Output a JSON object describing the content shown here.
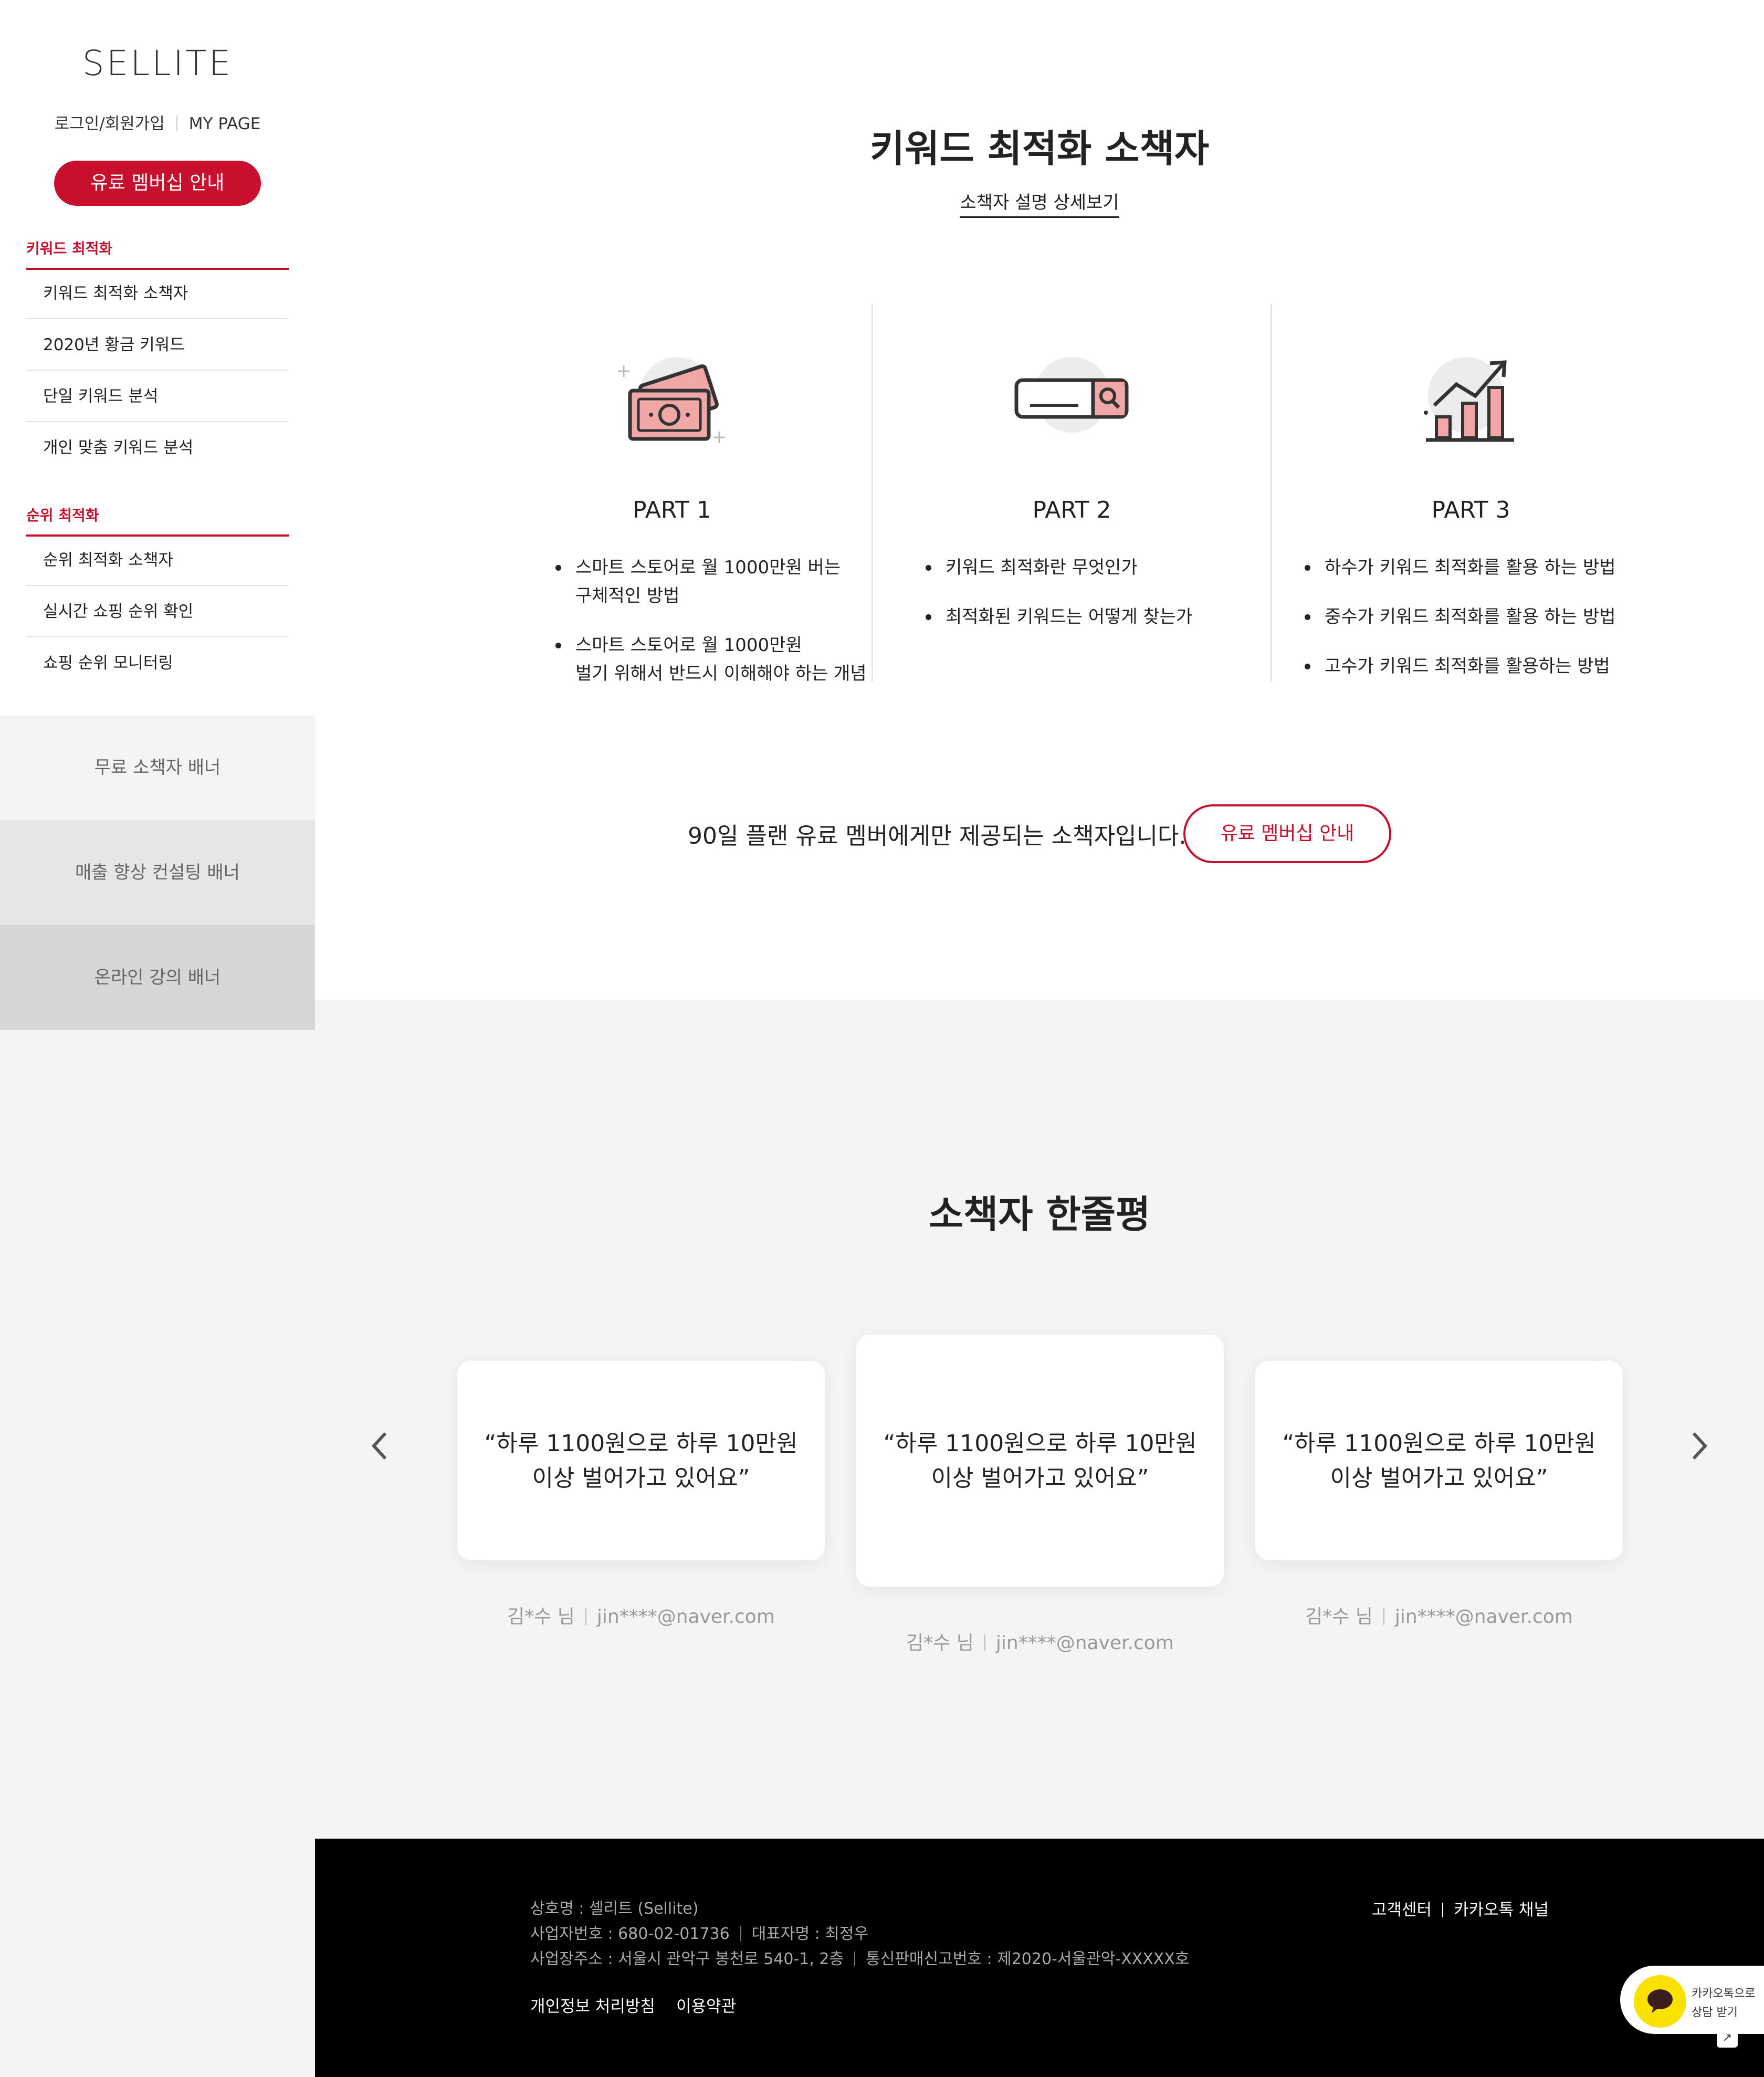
{
  "sidebar": {
    "logo": "SELLITE",
    "login_label": "로그인/회원가입",
    "mypage_label": "MY PAGE",
    "membership_button": "유료 멤버십 안내",
    "sections": [
      {
        "heading": "키워드 최적화",
        "items": [
          "키워드 최적화 소책자",
          "2020년 황금 키워드",
          "단일 키워드 분석",
          "개인 맞춤 키워드 분석"
        ]
      },
      {
        "heading": "순위 최적화",
        "items": [
          "순위 최적화 소책자",
          "실시간 쇼핑 순위 확인",
          "쇼핑 순위 모니터링"
        ]
      }
    ],
    "banners": [
      {
        "label": "무료 소책자 배너",
        "bg": "#f4f4f4"
      },
      {
        "label": "매출 향상 컨설팅 배너",
        "bg": "#e6e6e6"
      },
      {
        "label": "온라인 강의 배너",
        "bg": "#d6d6d6"
      }
    ]
  },
  "main": {
    "title": "키워드 최적화 소책자",
    "detail_link": "소책자 설명 상세보기",
    "parts": [
      {
        "icon": "money-icon",
        "title": "PART 1",
        "items": [
          "스마트 스토어로 월 1000만원 버는\n구체적인 방법",
          "스마트 스토어로 월 1000만원\n벌기 위해서 반드시 이해해야 하는 개념"
        ]
      },
      {
        "icon": "search-bar-icon",
        "title": "PART 2",
        "items": [
          "키워드 최적화란 무엇인가",
          "최적화된 키워드는 어떻게 찾는가"
        ]
      },
      {
        "icon": "growth-chart-icon",
        "title": "PART 3",
        "items": [
          "하수가 키워드 최적화를 활용 하는 방법",
          "중수가 키워드 최적화를 활용 하는 방법",
          "고수가 키워드 최적화를 활용하는 방법"
        ]
      }
    ],
    "cta_text": "90일 플랜 유료 멤버에게만 제공되는 소책자입니다.",
    "cta_button": "유료 멤버십 안내"
  },
  "reviews": {
    "title": "소책자 한줄평",
    "items": [
      {
        "quote": "“하루 1100원으로 하루 10만원\n이상 벌어가고 있어요”",
        "name": "김*수 님",
        "email": "jin****@naver.com"
      },
      {
        "quote": "“하루 1100원으로 하루 10만원\n이상 벌어가고 있어요”",
        "name": "김*수 님",
        "email": "jin****@naver.com"
      },
      {
        "quote": "“하루 1100원으로 하루 10만원\n이상 벌어가고 있어요”",
        "name": "김*수 님",
        "email": "jin****@naver.com"
      }
    ]
  },
  "footer": {
    "company": "상호명 : 셀리트 (Sellite)",
    "business_no": "사업자번호 : 680-02-01736",
    "ceo": "대표자명 : 최정우",
    "address": "사업장주소 : 서울시 관악구 봉천로 540-1, 2층",
    "mail_order_no": "통신판매신고번호 : 제2020-서울관악-XXXXX호",
    "privacy": "개인정보 처리방침",
    "terms": "이용약관",
    "support": "고객센터",
    "kakao_channel": "카카오톡 채널"
  },
  "kakao_widget": {
    "line1": "카카오톡으로",
    "line2": "상담 받기"
  },
  "colors": {
    "accent": "#c8102e",
    "kakao_yellow": "#fae100",
    "icon_pink": "#f2a7a7"
  }
}
